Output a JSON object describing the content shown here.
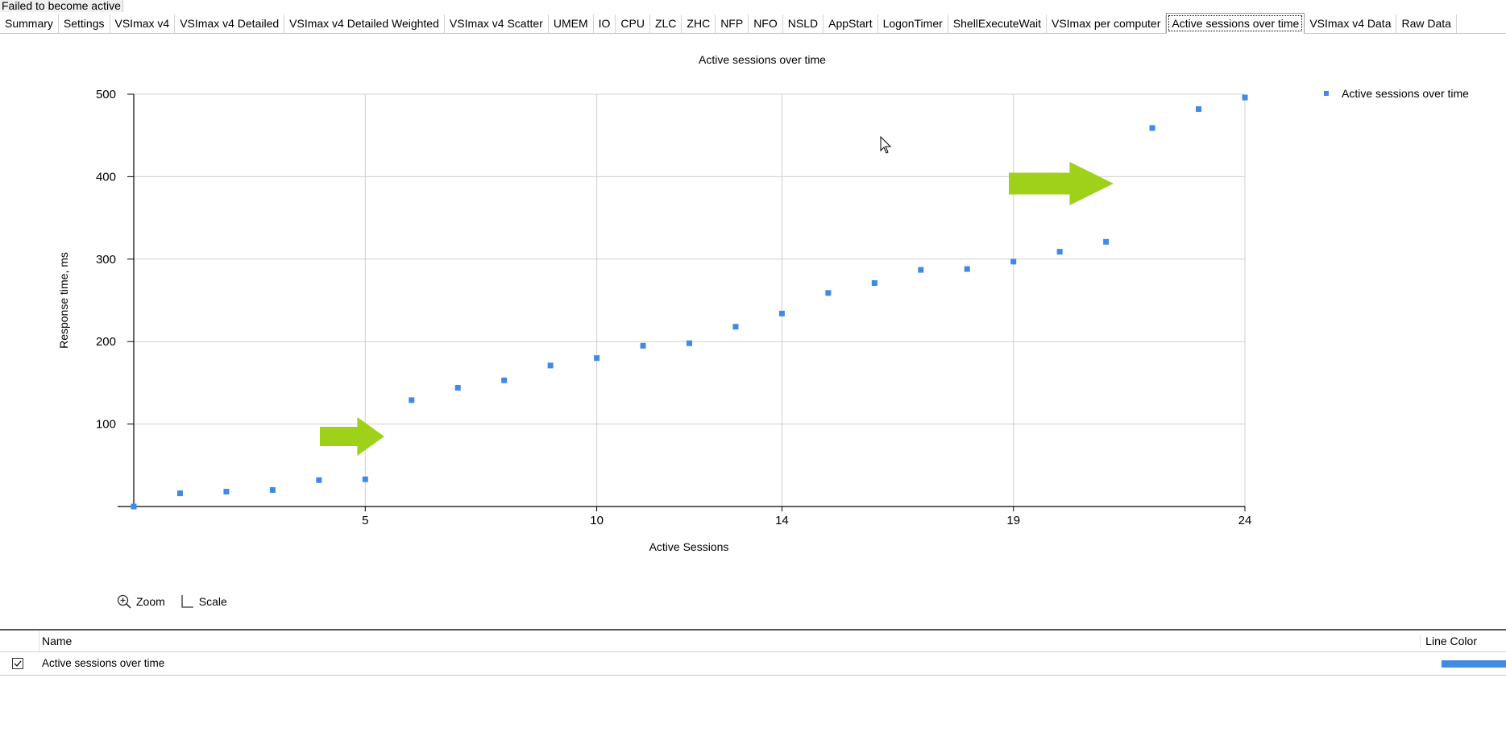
{
  "window": {
    "status_label": "Failed to become active"
  },
  "tabs": [
    {
      "label": "Summary"
    },
    {
      "label": "Settings"
    },
    {
      "label": "VSImax v4"
    },
    {
      "label": "VSImax v4 Detailed"
    },
    {
      "label": "VSImax v4 Detailed Weighted"
    },
    {
      "label": "VSImax v4 Scatter"
    },
    {
      "label": "UMEM"
    },
    {
      "label": "IO"
    },
    {
      "label": "CPU"
    },
    {
      "label": "ZLC"
    },
    {
      "label": "ZHC"
    },
    {
      "label": "NFP"
    },
    {
      "label": "NFO"
    },
    {
      "label": "NSLD"
    },
    {
      "label": "AppStart"
    },
    {
      "label": "LogonTimer"
    },
    {
      "label": "ShellExecuteWait"
    },
    {
      "label": "VSImax per computer"
    },
    {
      "label": "Active sessions over time",
      "active": true
    },
    {
      "label": "VSImax v4 Data"
    },
    {
      "label": "Raw Data"
    }
  ],
  "toolbar": {
    "zoom_label": "Zoom",
    "scale_label": "Scale",
    "zoom_icon": "zoom-in-icon",
    "scale_icon": "axis-scale-icon"
  },
  "legend_table": {
    "name_header": "Name",
    "color_header": "Line Color",
    "rows": [
      {
        "name": "Active sessions over time",
        "checked": true,
        "color": "#3f8ae6"
      }
    ]
  },
  "annotations": [
    {
      "type": "arrow",
      "color": "#9fd11a",
      "direction": "right"
    },
    {
      "type": "arrow",
      "color": "#9fd11a",
      "direction": "right"
    }
  ],
  "chart_data": {
    "type": "scatter",
    "title": "Active sessions over time",
    "xlabel": "Active Sessions",
    "ylabel": "Response time, ms",
    "xlim": [
      0,
      24
    ],
    "ylim": [
      0,
      500
    ],
    "xticks": [
      5,
      10,
      14,
      19,
      24
    ],
    "yticks": [
      100,
      200,
      300,
      400,
      500
    ],
    "grid": true,
    "legend_position": "top-right",
    "series": [
      {
        "name": "Active sessions over time",
        "color": "#3f8ae6",
        "x": [
          0,
          1,
          2,
          3,
          4,
          5,
          6,
          7,
          8,
          9,
          10,
          11,
          12,
          13,
          14,
          15,
          16,
          17,
          18,
          19,
          20,
          21,
          22,
          23,
          24
        ],
        "y": [
          0,
          16,
          18,
          20,
          32,
          33,
          129,
          144,
          153,
          171,
          180,
          195,
          198,
          218,
          234,
          259,
          271,
          287,
          288,
          297,
          309,
          321,
          459,
          482,
          496
        ]
      }
    ]
  }
}
